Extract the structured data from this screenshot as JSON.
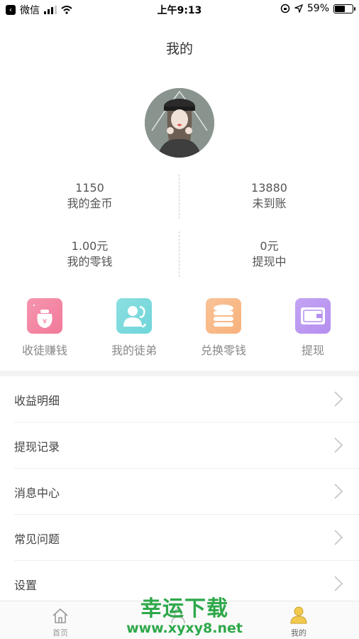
{
  "status_bar": {
    "app_back": "微信",
    "time": "上午9:13",
    "battery": "59%",
    "battery_level": 0.59
  },
  "header": {
    "title": "我的"
  },
  "stats": [
    {
      "value": "1150",
      "label": "我的金币"
    },
    {
      "value": "13880",
      "label": "未到账"
    },
    {
      "value": "1.00元",
      "label": "我的零钱"
    },
    {
      "value": "0元",
      "label": "提现中"
    }
  ],
  "actions": [
    {
      "label": "收徒赚钱",
      "icon": "money-bag-icon",
      "color": "#f27a9a"
    },
    {
      "label": "我的徒弟",
      "icon": "people-icon",
      "color": "#6fd6d9"
    },
    {
      "label": "兑换零钱",
      "icon": "coins-icon",
      "color": "#f8b27c"
    },
    {
      "label": "提现",
      "icon": "wallet-icon",
      "color": "#b58ef0"
    }
  ],
  "menu": [
    {
      "label": "收益明细"
    },
    {
      "label": "提现记录"
    },
    {
      "label": "消息中心"
    },
    {
      "label": "常见问题"
    },
    {
      "label": "设置"
    }
  ],
  "tabbar": [
    {
      "label": "首页",
      "icon": "home-icon",
      "active": false
    },
    {
      "label": "",
      "icon": "apprentice-icon",
      "active": false
    },
    {
      "label": "",
      "icon": "spacer",
      "active": false
    },
    {
      "label": "我的",
      "icon": "user-icon",
      "active": true
    }
  ],
  "watermark": {
    "title": "幸运下载",
    "url": "www.xyxy8.net"
  },
  "colors": {
    "accent_active": "#f2c94c",
    "watermark_green": "#2ea84a"
  }
}
